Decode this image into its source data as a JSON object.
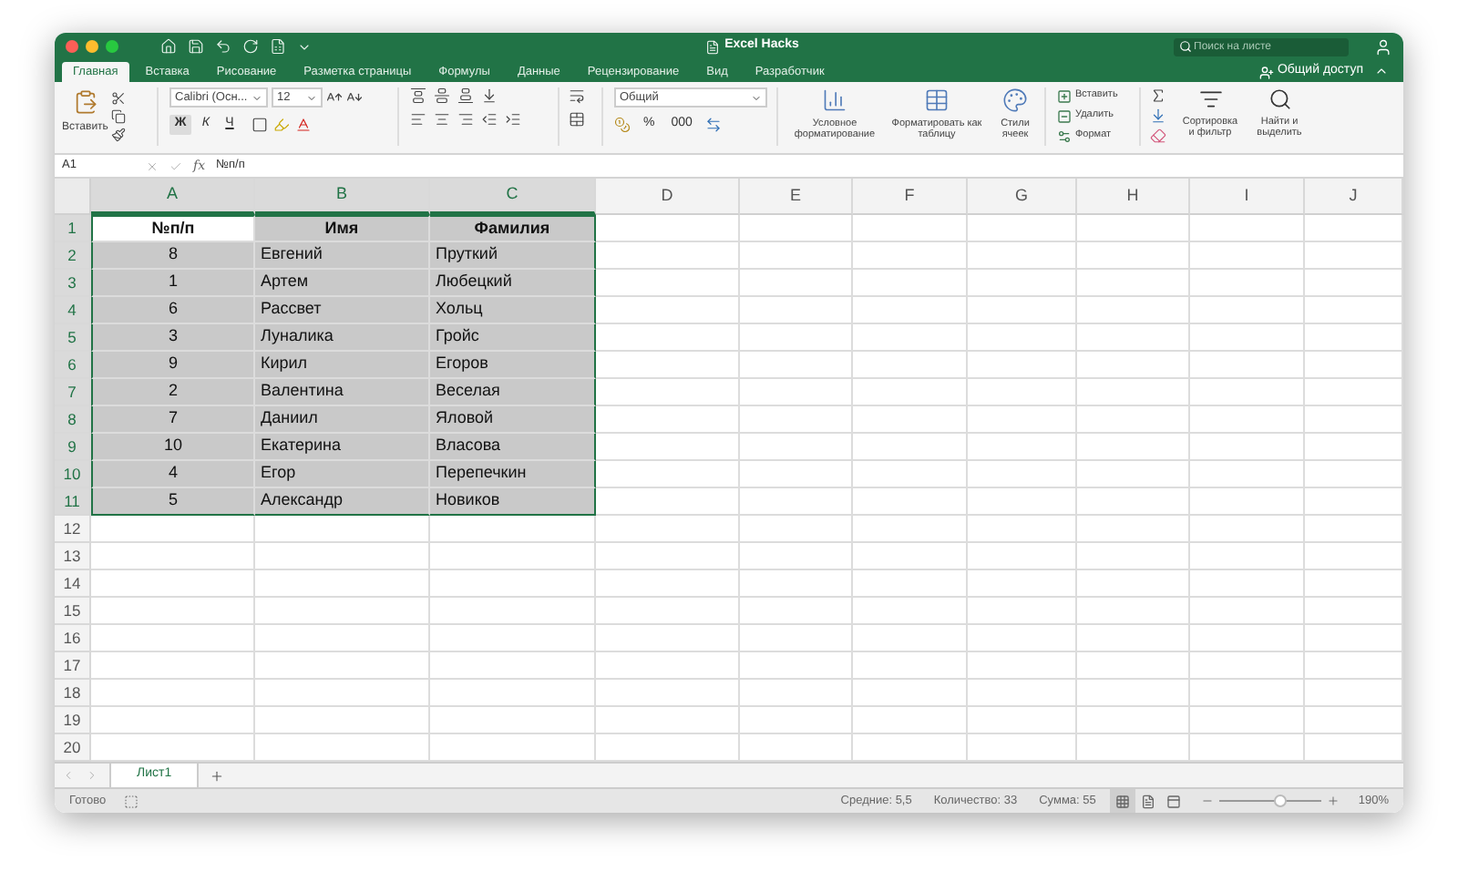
{
  "window": {
    "title": "Excel Hacks"
  },
  "search": {
    "placeholder": "Поиск на листе"
  },
  "tabs": [
    {
      "label": "Главная",
      "selected": true
    },
    {
      "label": "Вставка",
      "selected": false
    },
    {
      "label": "Рисование",
      "selected": false
    },
    {
      "label": "Разметка страницы",
      "selected": false
    },
    {
      "label": "Формулы",
      "selected": false
    },
    {
      "label": "Данные",
      "selected": false
    },
    {
      "label": "Рецензирование",
      "selected": false
    },
    {
      "label": "Вид",
      "selected": false
    },
    {
      "label": "Разработчик",
      "selected": false
    }
  ],
  "share": "Общий доступ",
  "ribbon": {
    "paste": "Вставить",
    "font_name": "Calibri (Осн...",
    "font_size": "12",
    "bold": "Ж",
    "italic": "К",
    "underline": "Ч",
    "number_format": "Общий",
    "percent": "%",
    "thousands": "000",
    "big_buttons": [
      {
        "kind": "conditional",
        "label": "Условное форматирование"
      },
      {
        "kind": "table",
        "label": "Форматировать как таблицу"
      },
      {
        "kind": "styles",
        "label": "Стили ячеек"
      }
    ],
    "cells": [
      {
        "kind": "insert",
        "label": "Вставить"
      },
      {
        "kind": "delete",
        "label": "Удалить"
      },
      {
        "kind": "format",
        "label": "Формат"
      }
    ],
    "editing": [
      {
        "kind": "sort",
        "label": "Сортировка и фильтр"
      },
      {
        "kind": "find",
        "label": "Найти и выделить"
      }
    ]
  },
  "formula_bar": {
    "cell": "A1",
    "fx": "fx",
    "formula": "№п/п"
  },
  "columns": [
    {
      "label": "A",
      "selected": true
    },
    {
      "label": "B",
      "selected": true
    },
    {
      "label": "C",
      "selected": true
    },
    {
      "label": "D",
      "selected": false
    },
    {
      "label": "E",
      "selected": false
    },
    {
      "label": "F",
      "selected": false
    },
    {
      "label": "G",
      "selected": false
    },
    {
      "label": "H",
      "selected": false
    },
    {
      "label": "I",
      "selected": false
    },
    {
      "label": "J",
      "selected": false
    }
  ],
  "rows": [
    {
      "number": "1",
      "kind": "header",
      "selected": true,
      "cells": [
        {
          "text": "№п/п",
          "active": true
        },
        {
          "text": "Имя",
          "active": false
        },
        {
          "text": "Фамилия",
          "active": false
        }
      ]
    },
    {
      "number": "2",
      "kind": "data",
      "selected": true,
      "cells": [
        {
          "text": "8",
          "active": false
        },
        {
          "text": "Евгений",
          "active": false
        },
        {
          "text": "Пруткий",
          "active": false
        }
      ]
    },
    {
      "number": "3",
      "kind": "data",
      "selected": true,
      "cells": [
        {
          "text": "1",
          "active": false
        },
        {
          "text": "Артем",
          "active": false
        },
        {
          "text": "Любецкий",
          "active": false
        }
      ]
    },
    {
      "number": "4",
      "kind": "data",
      "selected": true,
      "cells": [
        {
          "text": "6",
          "active": false
        },
        {
          "text": "Рассвет",
          "active": false
        },
        {
          "text": "Хольц",
          "active": false
        }
      ]
    },
    {
      "number": "5",
      "kind": "data",
      "selected": true,
      "cells": [
        {
          "text": "3",
          "active": false
        },
        {
          "text": "Луналика",
          "active": false
        },
        {
          "text": "Гройс",
          "active": false
        }
      ]
    },
    {
      "number": "6",
      "kind": "data",
      "selected": true,
      "cells": [
        {
          "text": "9",
          "active": false
        },
        {
          "text": "Кирил",
          "active": false
        },
        {
          "text": "Егоров",
          "active": false
        }
      ]
    },
    {
      "number": "7",
      "kind": "data",
      "selected": true,
      "cells": [
        {
          "text": "2",
          "active": false
        },
        {
          "text": "Валентина",
          "active": false
        },
        {
          "text": "Веселая",
          "active": false
        }
      ]
    },
    {
      "number": "8",
      "kind": "data",
      "selected": true,
      "cells": [
        {
          "text": "7",
          "active": false
        },
        {
          "text": "Даниил",
          "active": false
        },
        {
          "text": "Яловой",
          "active": false
        }
      ]
    },
    {
      "number": "9",
      "kind": "data",
      "selected": true,
      "cells": [
        {
          "text": "10",
          "active": false
        },
        {
          "text": "Екатерина",
          "active": false
        },
        {
          "text": "Власова",
          "active": false
        }
      ]
    },
    {
      "number": "10",
      "kind": "data",
      "selected": true,
      "cells": [
        {
          "text": "4",
          "active": false
        },
        {
          "text": "Егор",
          "active": false
        },
        {
          "text": "Перепечкин",
          "active": false
        }
      ]
    },
    {
      "number": "11",
      "kind": "data",
      "selected": true,
      "cells": [
        {
          "text": "5",
          "active": false
        },
        {
          "text": "Александр",
          "active": false
        },
        {
          "text": "Новиков",
          "active": false
        }
      ]
    },
    {
      "number": "12",
      "kind": "empty",
      "selected": false
    },
    {
      "number": "13",
      "kind": "empty",
      "selected": false
    },
    {
      "number": "14",
      "kind": "empty",
      "selected": false
    },
    {
      "number": "15",
      "kind": "empty",
      "selected": false
    },
    {
      "number": "16",
      "kind": "empty",
      "selected": false
    },
    {
      "number": "17",
      "kind": "empty",
      "selected": false
    },
    {
      "number": "18",
      "kind": "empty",
      "selected": false
    },
    {
      "number": "19",
      "kind": "empty",
      "selected": false
    },
    {
      "number": "20",
      "kind": "empty",
      "selected": false
    }
  ],
  "sheets": [
    {
      "label": "Лист1",
      "selected": true
    }
  ],
  "status_bar": {
    "ready": "Готово",
    "average": "Средние: 5,5",
    "count": "Количество: 33",
    "sum": "Сумма: 55",
    "views": [
      {
        "kind": "normal",
        "selected": true
      },
      {
        "kind": "page",
        "selected": false
      },
      {
        "kind": "break",
        "selected": false
      }
    ],
    "zoom": {
      "level": 0.6,
      "reading": "190%"
    }
  }
}
